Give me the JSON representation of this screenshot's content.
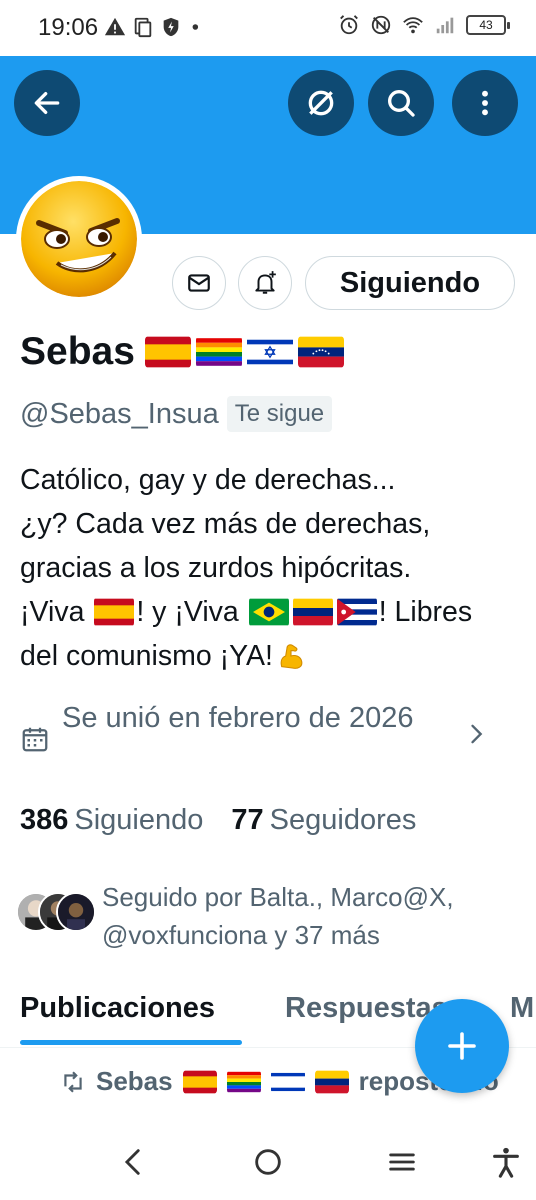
{
  "status_bar": {
    "time": "19:06",
    "battery": "43"
  },
  "header": {
    "banner_color": "#1d9bf0",
    "back_icon": "arrow-left-icon",
    "grok_icon": "slash-circle-icon",
    "search_icon": "search-icon",
    "more_icon": "more-vertical-icon"
  },
  "profile": {
    "display_name": "Sebas",
    "name_flags": [
      "spain",
      "rainbow",
      "israel",
      "venezuela"
    ],
    "handle": "@Sebas_Insua",
    "follows_you": "Te sigue",
    "follow_button": "Siguiendo",
    "bio": {
      "line1": "Católico, gay y de derechas...",
      "line2": "¿y? Cada vez más de derechas,",
      "line3": "gracias a los zurdos hipócritas.",
      "line4_a": "¡Viva ",
      "line4_b": "! y ¡Viva ",
      "line4_c": "! Libres",
      "line5": "del comunismo ¡YA!"
    },
    "joined": "Se unió en febrero de 2026",
    "following_count": "386",
    "following_label": "Siguiendo",
    "followers_count": "77",
    "followers_label": "Seguidores",
    "followed_by": "Seguido por Balta., Marco@X, @voxfunciona y 37 más"
  },
  "tabs": [
    {
      "label": "Publicaciones",
      "active": true
    },
    {
      "label": "Respuestas",
      "active": false
    },
    {
      "label": "M",
      "active": false
    }
  ],
  "repost": {
    "name": "Sebas",
    "suffix": "reposteado"
  },
  "accent_color": "#1d9bf0"
}
